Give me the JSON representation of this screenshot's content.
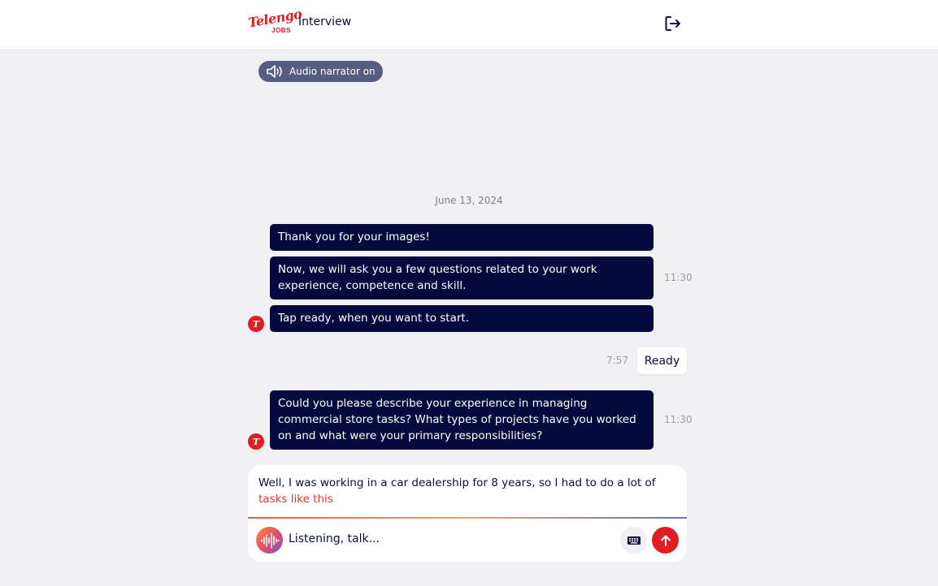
{
  "header": {
    "logo_text": "Telengo",
    "logo_subtext": "JOBS",
    "title": "Interview",
    "exit_icon": "logout-icon"
  },
  "narrator": {
    "label": "Audio narrator on",
    "icon": "speaker-icon"
  },
  "chat": {
    "date": "June 13, 2024",
    "messages": [
      {
        "sender": "bot",
        "text": "Thank you for your images!"
      },
      {
        "sender": "bot",
        "text": "Now, we will ask you a few questions related to your work experience, competence and skill."
      },
      {
        "sender": "bot",
        "text": "Tap ready, when you want to start.",
        "time": "11:30"
      },
      {
        "sender": "user",
        "text": "Ready",
        "time": "7:57"
      },
      {
        "sender": "bot",
        "text": "Could you please describe your experience in managing commercial store tasks? What types of projects have you worked on and what were your primary responsibilities?",
        "time": "11:30"
      }
    ],
    "avatar_glyph": "T"
  },
  "composer": {
    "transcript_final": "Well, I was working in a car dealership for 8 years, so I had to do a lot of",
    "transcript_interim": "tasks like this",
    "status": "Listening, talk...",
    "mic_icon": "soundwave-icon",
    "keyboard_icon": "keyboard-icon",
    "send_icon": "arrow-up-icon"
  },
  "colors": {
    "brand_red": "#e31b23",
    "bubble_navy": "#050a3c",
    "narrator_bg": "#555e80",
    "background": "#f1f1f3"
  }
}
